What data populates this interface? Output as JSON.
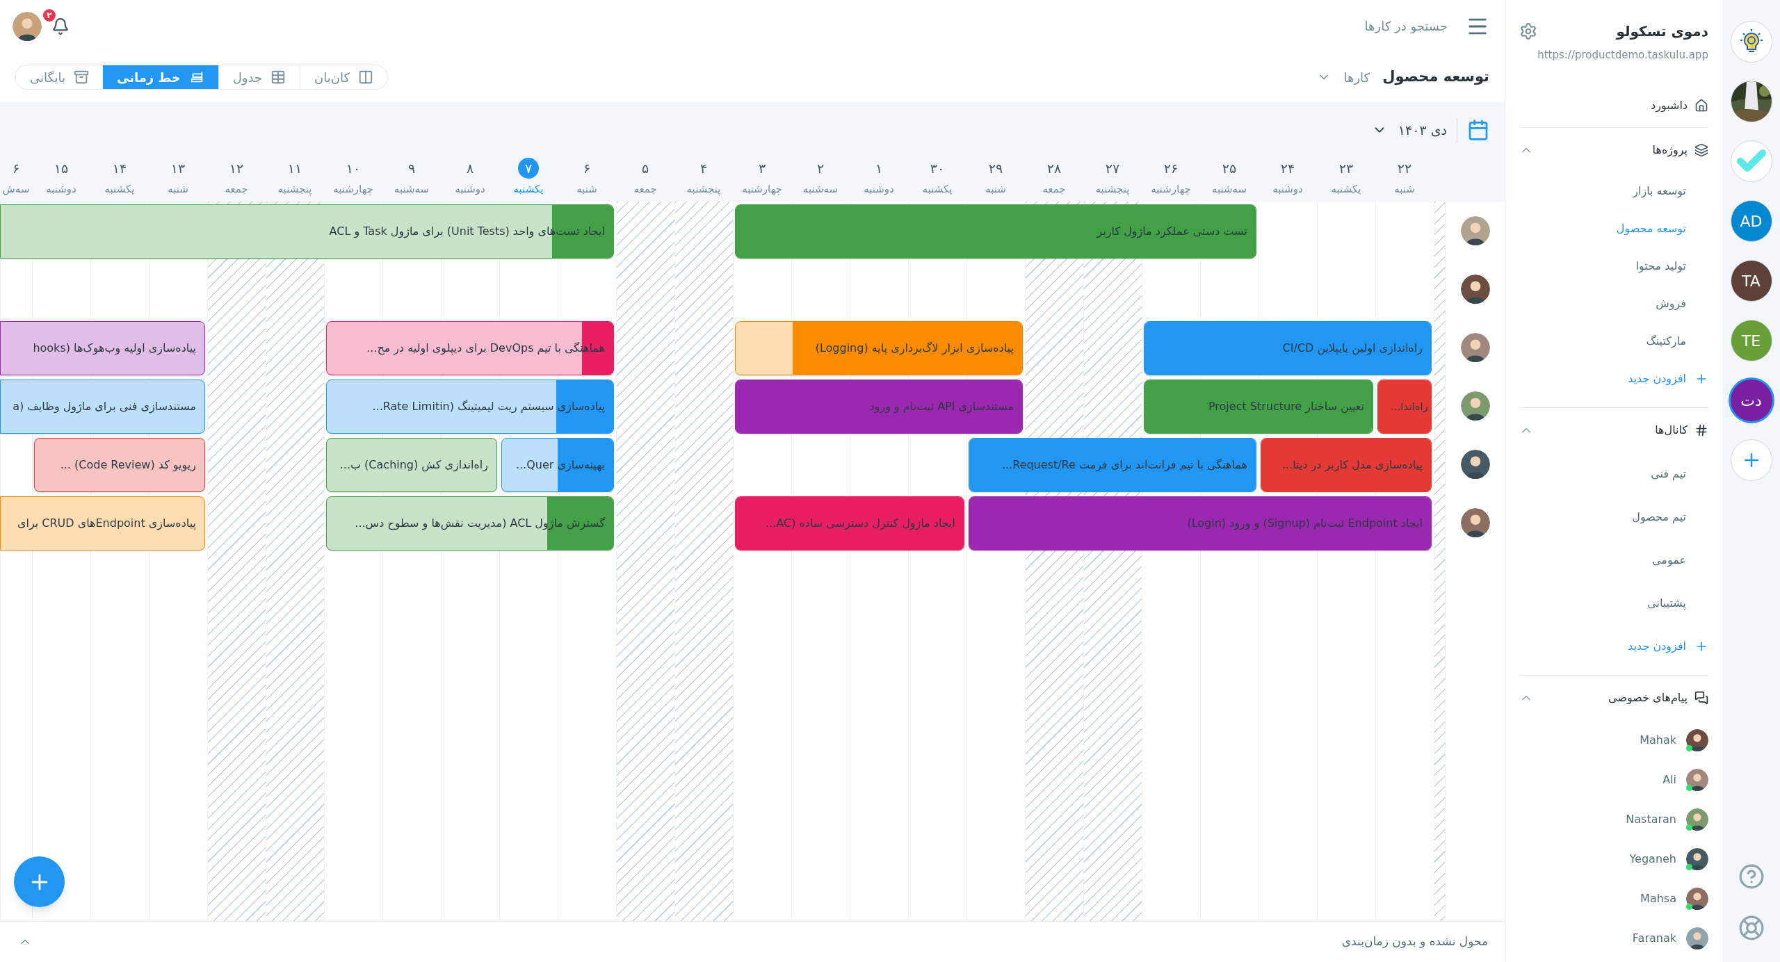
{
  "header": {
    "notifications": {
      "count": "۲"
    },
    "search": {
      "placeholder": "جستجو در کارها"
    }
  },
  "toolbar": {
    "project_title": "توسعه محصول",
    "section": "کارها",
    "view_tabs": [
      {
        "label": "کان‌بان",
        "kind": "kanban",
        "selected": false
      },
      {
        "label": "جدول",
        "kind": "table",
        "selected": false
      },
      {
        "label": "خط زمانی",
        "kind": "timeline",
        "selected": true
      },
      {
        "label": "بایگانی",
        "kind": "archive",
        "selected": false
      }
    ]
  },
  "timeline": {
    "month": "دی ۱۴۰۳",
    "columns": [
      {
        "kind": "edge",
        "holiday": true
      },
      {
        "kind": "day",
        "number": "۲۲",
        "weekday": "شنبه",
        "holiday": false,
        "selected": false
      },
      {
        "kind": "day",
        "number": "۲۳",
        "weekday": "یکشنبه",
        "holiday": false,
        "selected": false
      },
      {
        "kind": "day",
        "number": "۲۴",
        "weekday": "دوشنبه",
        "holiday": false,
        "selected": false
      },
      {
        "kind": "day",
        "number": "۲۵",
        "weekday": "سه‌شنبه",
        "holiday": false,
        "selected": false
      },
      {
        "kind": "day",
        "number": "۲۶",
        "weekday": "چهارشنبه",
        "holiday": false,
        "selected": false
      },
      {
        "kind": "day",
        "number": "۲۷",
        "weekday": "پنجشنبه",
        "holiday": true,
        "selected": false
      },
      {
        "kind": "day",
        "number": "۲۸",
        "weekday": "جمعه",
        "holiday": true,
        "selected": false
      },
      {
        "kind": "day",
        "number": "۲۹",
        "weekday": "شنبه",
        "holiday": false,
        "selected": false
      },
      {
        "kind": "day",
        "number": "۳۰",
        "weekday": "یکشنبه",
        "holiday": false,
        "selected": false
      },
      {
        "kind": "day",
        "number": "۱",
        "weekday": "دوشنبه",
        "holiday": false,
        "selected": false
      },
      {
        "kind": "day",
        "number": "۲",
        "weekday": "سه‌شنبه",
        "holiday": false,
        "selected": false
      },
      {
        "kind": "day",
        "number": "۳",
        "weekday": "چهارشنبه",
        "holiday": false,
        "selected": false
      },
      {
        "kind": "day",
        "number": "۴",
        "weekday": "پنجشنبه",
        "holiday": true,
        "selected": false
      },
      {
        "kind": "day",
        "number": "۵",
        "weekday": "جمعه",
        "holiday": true,
        "selected": false
      },
      {
        "kind": "day",
        "number": "۶",
        "weekday": "شنبه",
        "holiday": false,
        "selected": false
      },
      {
        "kind": "day",
        "number": "۷",
        "weekday": "یکشنبه",
        "holiday": false,
        "selected": true
      },
      {
        "kind": "day",
        "number": "۸",
        "weekday": "دوشنبه",
        "holiday": false,
        "selected": false
      },
      {
        "kind": "day",
        "number": "۹",
        "weekday": "سه‌شنبه",
        "holiday": false,
        "selected": false
      },
      {
        "kind": "day",
        "number": "۱۰",
        "weekday": "چهارشنبه",
        "holiday": false,
        "selected": false
      },
      {
        "kind": "day",
        "number": "۱۱",
        "weekday": "پنجشنبه",
        "holiday": true,
        "selected": false
      },
      {
        "kind": "day",
        "number": "۱۲",
        "weekday": "جمعه",
        "holiday": true,
        "selected": false
      },
      {
        "kind": "day",
        "number": "۱۳",
        "weekday": "شنبه",
        "holiday": false,
        "selected": false
      },
      {
        "kind": "day",
        "number": "۱۴",
        "weekday": "یکشنبه",
        "holiday": false,
        "selected": false
      },
      {
        "kind": "day",
        "number": "۱۵",
        "weekday": "دوشنبه",
        "holiday": false,
        "selected": false
      },
      {
        "kind": "edge",
        "number": "۶",
        "weekday": "سه‌ش",
        "holiday": false
      }
    ],
    "lanes": [
      {
        "kind": "person",
        "bars": [
          {
            "title": "تست دستی عملکرد ماژول کاربر",
            "color": "#43a047",
            "level": 1
          },
          {
            "title": "ایجاد تست‌های واحد (Unit Tests) برای ماژول Task و ACL",
            "color": "#43a047",
            "level": 0.1
          }
        ]
      },
      {
        "kind": "person"
      },
      {
        "kind": "person",
        "bars": [
          {
            "title": "راه‌اندازی اولین پایپلاین CI/CD",
            "color": "#2196f3",
            "level": 1
          },
          {
            "title": "پیاده‌سازی ابزار لاگ‌برداری پایه (Logging)",
            "color": "#fb8c00",
            "level": 0.8
          },
          {
            "title": "هماهنگی با تیم DevOps برای دیپلوی اولیه در مح...",
            "color": "#e91e63",
            "level": 0.11
          },
          {
            "title": "پیاده‌سازی اولیه وب‌هوک‌ها (hooks",
            "color": "#9c27b0"
          }
        ]
      },
      {
        "kind": "person",
        "bars": [
          {
            "title": "راه‌اندا...",
            "color": "#e53935",
            "level": 1
          },
          {
            "title": "تعیین ساختار Project Structure",
            "color": "#43a047",
            "level": 1
          },
          {
            "title": "مستندسازی API ثبت‌نام و ورود",
            "color": "#9c27b0",
            "level": 1
          },
          {
            "title": "پیاده‌سازی سیستم ریت لیمیتینگ (Rate Limitin...",
            "color": "#2196f3",
            "level": 0.2
          },
          {
            "title": "مستندسازی فنی برای ماژول وظایف (a",
            "color": "#2196f3"
          }
        ]
      },
      {
        "kind": "person",
        "bars": [
          {
            "title": "پیاده‌سازی مدل کاربر در دیتا...",
            "color": "#e53935",
            "level": 1
          },
          {
            "title": "هماهنگی با تیم فرانت‌اند برای فرمت Request/Re...",
            "color": "#2196f3",
            "level": 1
          },
          {
            "title": "بهینه‌سازی Quer...",
            "color": "#2196f3",
            "level": 0.5
          },
          {
            "title": "راه‌اندازی کش (Caching) ب...",
            "color": "#43a047"
          },
          {
            "title": "ریویو کد (Code Review) ...",
            "color": "#e53935"
          }
        ]
      },
      {
        "kind": "person",
        "bars": [
          {
            "title": "ایجاد Endpoint ثبت‌نام (Signup) و ورود (Login)",
            "color": "#9c27b0",
            "level": 1
          },
          {
            "title": "ایجاد ماژول کنترل دسترسی ساده (AC...",
            "color": "#e91e63",
            "level": 1
          },
          {
            "title": "گسترش ماژول ACL (مدیریت نقش‌ها و سطوح دس...",
            "color": "#43a047",
            "level": 0.23
          },
          {
            "title": "پیاده‌سازی Endpointهای CRUD برای",
            "color": "#fb8c00"
          }
        ]
      }
    ],
    "unassigned": {
      "label": "محول نشده و بدون زمان‌بندی",
      "expanded": false
    }
  },
  "sidebar": {
    "workspace": {
      "name": "دموی تسکولو",
      "url": "https://productdemo.taskulu.app"
    },
    "nav": [
      {
        "label": "داشبورد"
      }
    ],
    "projects": {
      "title": "پروژه‌ها",
      "expanded": true,
      "items": [
        {
          "label": "توسعه بازار",
          "selected": false
        },
        {
          "label": "توسعه محصول",
          "selected": true
        },
        {
          "label": "تولید محتوا",
          "selected": false
        },
        {
          "label": "فروش",
          "selected": false
        },
        {
          "label": "مارکتینگ",
          "selected": false
        }
      ],
      "add": "افزودن جدید"
    },
    "channels": {
      "title": "کانال‌ها",
      "expanded": true,
      "items": [
        {
          "label": "تیم فنی",
          "selected": false
        },
        {
          "label": "تیم محصول",
          "selected": false
        },
        {
          "label": "عمومی",
          "selected": false
        },
        {
          "label": "پشتیبانی",
          "selected": false
        }
      ],
      "add": "افزودن جدید"
    },
    "direct_messages": {
      "title": "پیام‌های خصوصی",
      "expanded": true,
      "users": [
        {
          "name": "Mahak",
          "online": true
        },
        {
          "name": "Ali",
          "online": true
        },
        {
          "name": "Nastaran",
          "online": true
        },
        {
          "name": "Yeganeh",
          "online": true
        },
        {
          "name": "Mahsa",
          "online": true
        },
        {
          "name": "Faranak",
          "online": false
        }
      ]
    }
  },
  "rail": {
    "workspaces": [
      {
        "kind": "logo",
        "selected": false
      },
      {
        "kind": "picture",
        "selected": false
      },
      {
        "kind": "check",
        "selected": false
      },
      {
        "kind": "initials",
        "initials": "AD",
        "color": "#0288d1",
        "selected": false
      },
      {
        "kind": "initials",
        "initials": "TA",
        "color": "#5d4037",
        "selected": false
      },
      {
        "kind": "initials",
        "initials": "TE",
        "color": "#689f38",
        "selected": false
      },
      {
        "kind": "initials",
        "initials": "دت",
        "color": "#7b1fa2",
        "selected": true
      }
    ]
  }
}
